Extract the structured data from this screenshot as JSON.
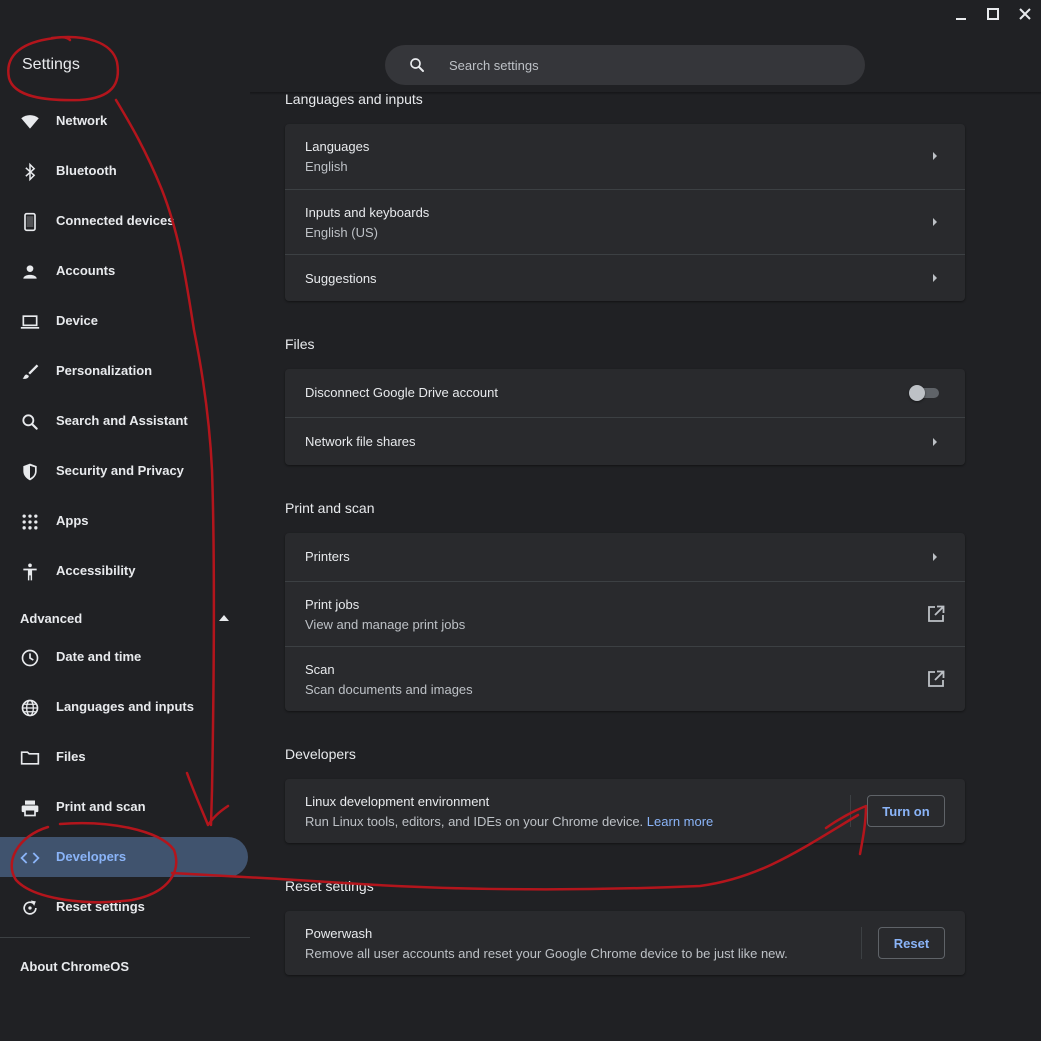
{
  "app": {
    "title": "Settings"
  },
  "search": {
    "placeholder": "Search settings"
  },
  "window_controls": [
    "minimize-icon",
    "maximize-icon",
    "close-icon"
  ],
  "sidebar": {
    "items": [
      {
        "label": "Network",
        "icon": "wifi-icon"
      },
      {
        "label": "Bluetooth",
        "icon": "bluetooth-icon"
      },
      {
        "label": "Connected devices",
        "icon": "phone-icon"
      },
      {
        "label": "Accounts",
        "icon": "person-icon"
      },
      {
        "label": "Device",
        "icon": "laptop-icon"
      },
      {
        "label": "Personalization",
        "icon": "brush-icon"
      },
      {
        "label": "Search and Assistant",
        "icon": "search-icon"
      },
      {
        "label": "Security and Privacy",
        "icon": "shield-icon"
      },
      {
        "label": "Apps",
        "icon": "apps-grid-icon"
      },
      {
        "label": "Accessibility",
        "icon": "accessibility-icon"
      }
    ],
    "advanced_label": "Advanced",
    "advanced_items": [
      {
        "label": "Date and time",
        "icon": "clock-icon"
      },
      {
        "label": "Languages and inputs",
        "icon": "globe-icon"
      },
      {
        "label": "Files",
        "icon": "folder-icon"
      },
      {
        "label": "Print and scan",
        "icon": "printer-icon"
      },
      {
        "label": "Developers",
        "icon": "code-icon",
        "selected": true
      },
      {
        "label": "Reset settings",
        "icon": "reset-icon"
      }
    ],
    "about_label": "About ChromeOS"
  },
  "sections": {
    "languages": {
      "title": "Languages and inputs",
      "rows": [
        {
          "label": "Languages",
          "sub": "English"
        },
        {
          "label": "Inputs and keyboards",
          "sub": "English (US)"
        },
        {
          "label": "Suggestions"
        }
      ]
    },
    "files": {
      "title": "Files",
      "rows": [
        {
          "label": "Disconnect Google Drive account",
          "toggle_on": false
        },
        {
          "label": "Network file shares"
        }
      ]
    },
    "print": {
      "title": "Print and scan",
      "rows": [
        {
          "label": "Printers"
        },
        {
          "label": "Print jobs",
          "sub": "View and manage print jobs"
        },
        {
          "label": "Scan",
          "sub": "Scan documents and images"
        }
      ]
    },
    "developers": {
      "title": "Developers",
      "rows": [
        {
          "label": "Linux development environment",
          "sub": "Run Linux tools, editors, and IDEs on your Chrome device.",
          "link": "Learn more",
          "button": "Turn on"
        }
      ]
    },
    "reset": {
      "title": "Reset settings",
      "rows": [
        {
          "label": "Powerwash",
          "sub": "Remove all user accounts and reset your Google Chrome device to be just like new.",
          "button": "Reset"
        }
      ]
    }
  },
  "colors": {
    "background": "#202124",
    "card": "#292a2d",
    "accent": "#8ab4f8",
    "selected_nav": "#40536e",
    "annotation_ink": "#b3151c"
  }
}
